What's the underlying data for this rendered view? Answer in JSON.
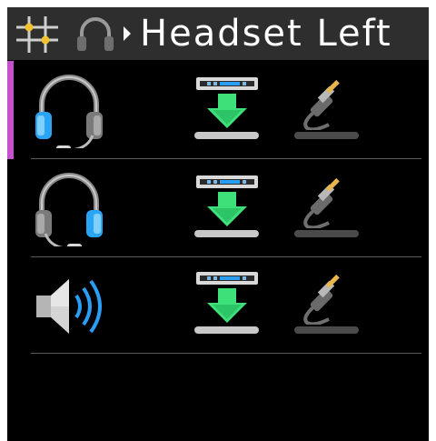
{
  "header": {
    "title": "Headset Left",
    "icons": [
      "mixer-icon",
      "headphones-icon",
      "breadcrumb-arrow-icon"
    ]
  },
  "rows": [
    {
      "device": "headset-left-ear-icon",
      "selected": true,
      "route": "download-to-device-icon",
      "jack": "audio-jack-icon"
    },
    {
      "device": "headset-right-ear-icon",
      "selected": false,
      "route": "download-to-device-icon",
      "jack": "audio-jack-icon"
    },
    {
      "device": "speaker-icon",
      "selected": false,
      "route": "download-to-device-icon",
      "jack": "audio-jack-icon"
    }
  ],
  "colors": {
    "header_bg": "#2e2e2e",
    "selection": "#c84fd0",
    "accent_green": "#3ee07a",
    "accent_blue": "#2a9df4",
    "jack_gold": "#e8b64a"
  }
}
